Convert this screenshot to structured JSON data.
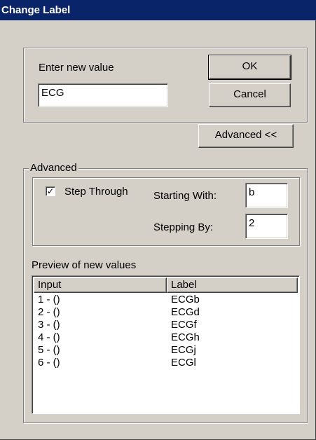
{
  "window": {
    "title": "Change Label"
  },
  "entry": {
    "prompt": "Enter new value",
    "value": "ECG",
    "ok_label": "OK",
    "cancel_label": "Cancel",
    "advanced_button_label": "Advanced <<"
  },
  "advanced": {
    "group_label": "Advanced",
    "step_through_label": "Step Through",
    "step_through_checked": true,
    "starting_with_label": "Starting With:",
    "starting_with_value": "b",
    "stepping_by_label": "Stepping By:",
    "stepping_by_value": "2",
    "preview_label": "Preview of new values",
    "preview": {
      "columns": [
        "Input",
        "Label"
      ],
      "rows": [
        [
          "1 - ()",
          "ECGb"
        ],
        [
          "2 - ()",
          "ECGd"
        ],
        [
          "3 - ()",
          "ECGf"
        ],
        [
          "4 - ()",
          "ECGh"
        ],
        [
          "5 - ()",
          "ECGj"
        ],
        [
          "6 - ()",
          "ECGl"
        ]
      ]
    }
  }
}
